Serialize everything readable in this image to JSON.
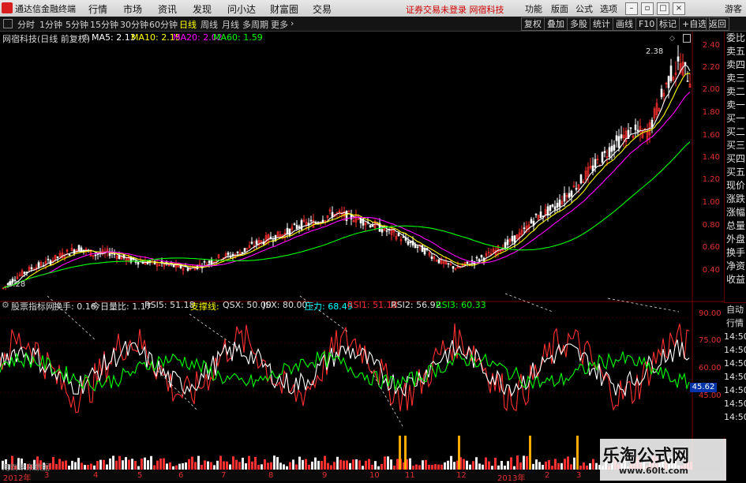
{
  "menubar": {
    "app_title": "通达信金融终端",
    "items": [
      "行情",
      "市场",
      "资讯",
      "发现",
      "问小达",
      "财富圈",
      "交易"
    ],
    "notice": "证券交易未登录  网宿科技",
    "right_items": [
      "功能",
      "版面",
      "公式",
      "选项"
    ],
    "guest": "游客"
  },
  "toolbar": {
    "periods": [
      "分时",
      "1分钟",
      "5分钟",
      "15分钟",
      "30分钟",
      "60分钟",
      "日线",
      "周线",
      "月线",
      "多周期",
      "更多"
    ],
    "active_period": "日线",
    "right_buttons": [
      "复权",
      "叠加",
      "多股",
      "统计",
      "画线",
      "F10",
      "标记",
      "+自选",
      "返回"
    ]
  },
  "price_panel": {
    "stock_label": "网宿科技(日线 前复权)",
    "ma": [
      {
        "label": "MA5: 2.13",
        "color": "#ffffff"
      },
      {
        "label": "MA10: 2.15",
        "color": "#ffff00"
      },
      {
        "label": "MA20: 2.02",
        "color": "#ff00ff"
      },
      {
        "label": "MA60: 1.59",
        "color": "#00ff00"
      }
    ],
    "high_marker": "2.38",
    "low_marker": "0.28",
    "y_ticks": [
      "2.40",
      "2.20",
      "2.00",
      "1.80",
      "1.60",
      "1.40",
      "1.20",
      "1.00",
      "0.80",
      "0.60",
      "0.40"
    ]
  },
  "indicator_panel": {
    "label": "股票指标网",
    "values": [
      {
        "label": "换手: 0.16",
        "color": "#e0e0e0"
      },
      {
        "label": "今日量比: 1.17",
        "color": "#e0e0e0"
      },
      {
        "label": "RSI5: 51.18",
        "color": "#e0e0e0"
      },
      {
        "label": "支撑线:",
        "color": "#ffff00"
      },
      {
        "label": "QSX: 50.00",
        "color": "#e0e0e0"
      },
      {
        "label": "JSX: 80.00",
        "color": "#e0e0e0"
      },
      {
        "label": "压力: 68.49",
        "color": "#00ffff"
      },
      {
        "label": "RSI1: 51.18",
        "color": "#ff3030"
      },
      {
        "label": "RSI2: 56.92",
        "color": "#e0e0e0"
      },
      {
        "label": "RSI3: 60.33",
        "color": "#00ff00"
      }
    ],
    "y_ticks": [
      "90.00",
      "75.00",
      "60.00",
      "45.00"
    ],
    "current_value": "45.62"
  },
  "side_panel": {
    "price_items": [
      "委比",
      "卖五",
      "卖四",
      "卖三",
      "卖二",
      "卖一",
      "买一",
      "买二",
      "买三",
      "买四",
      "买五",
      "现价",
      "涨跌",
      "涨幅",
      "总量",
      "外盘",
      "换手",
      "净资",
      "收益"
    ],
    "lower_items": [
      "自动",
      "行情",
      "14:50",
      "14:50",
      "14:50",
      "14:50",
      "14:50",
      "14:50",
      "14:50"
    ]
  },
  "bottom": {
    "note": "用到未来数据",
    "months": [
      "2012年",
      "3",
      "4",
      "5",
      "6",
      "7",
      "8",
      "9",
      "10",
      "11",
      "12",
      "2013年",
      "2",
      "3"
    ]
  },
  "watermark": {
    "title": "乐淘公式网",
    "url": "www.60lt.com"
  },
  "colors": {
    "candle_up": "#ff3030",
    "candle_down": "#ffffff",
    "ma5": "#ffffff",
    "ma10": "#ffff00",
    "ma20": "#ff00ff",
    "ma60": "#00ff00",
    "rsi1": "#ff3030",
    "rsi2": "#ffffff",
    "rsi3": "#00ff00"
  }
}
